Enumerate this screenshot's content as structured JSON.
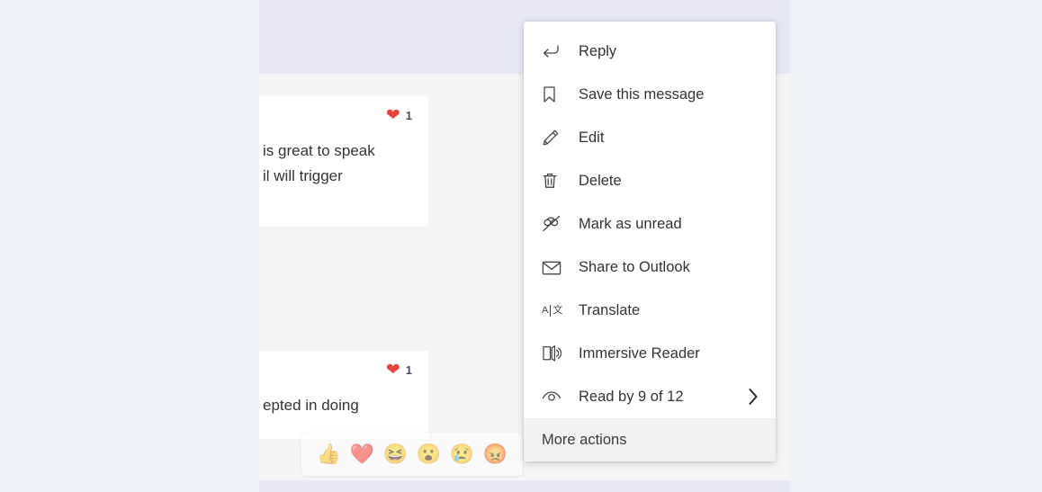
{
  "app": {
    "name": "microsoft-teams-chat",
    "background_color": "#eff3f7",
    "content_background_color": "#f5f5f5",
    "highlight_band_color": "#e7e8f3"
  },
  "messages": [
    {
      "text_line_1": "is great to speak",
      "text_line_2": "il will trigger",
      "reaction": {
        "emoji": "❤",
        "emoji_name": "heart-reaction",
        "count": "1",
        "color": "#e8453c"
      }
    },
    {
      "text_line_1": "epted in doing",
      "text_line_2": "",
      "reaction": {
        "emoji": "❤",
        "emoji_name": "heart-reaction",
        "count": "1",
        "color": "#e8453c"
      }
    }
  ],
  "reaction_bar": {
    "name": "emoji-reaction-picker",
    "emojis": [
      {
        "name": "thumbs-up-emoji",
        "glyph": "👍"
      },
      {
        "name": "heart-emoji",
        "glyph": "❤️"
      },
      {
        "name": "laugh-emoji",
        "glyph": "😆"
      },
      {
        "name": "surprised-emoji",
        "glyph": "😮"
      },
      {
        "name": "sad-emoji",
        "glyph": "😢"
      },
      {
        "name": "angry-emoji",
        "glyph": "😡"
      }
    ]
  },
  "context_menu": {
    "name": "message-context-menu",
    "items": [
      {
        "id": "reply",
        "label": "Reply",
        "icon": "reply-arrow-icon",
        "has_submenu": false
      },
      {
        "id": "save",
        "label": "Save this message",
        "icon": "bookmark-icon",
        "has_submenu": false
      },
      {
        "id": "edit",
        "label": "Edit",
        "icon": "pencil-icon",
        "has_submenu": false
      },
      {
        "id": "delete",
        "label": "Delete",
        "icon": "trash-icon",
        "has_submenu": false
      },
      {
        "id": "mark-as-unread",
        "label": "Mark as unread",
        "icon": "mail-unread-icon",
        "has_submenu": false
      },
      {
        "id": "share-to-outlook",
        "label": "Share to Outlook",
        "icon": "envelope-icon",
        "has_submenu": false
      },
      {
        "id": "translate",
        "label": "Translate",
        "icon": "translate-icon",
        "has_submenu": false
      },
      {
        "id": "immersive-reader",
        "label": "Immersive Reader",
        "icon": "immersive-reader-icon",
        "has_submenu": false
      },
      {
        "id": "read-by",
        "label": "Read by 9 of 12",
        "icon": "eye-icon",
        "has_submenu": true
      }
    ],
    "footer": {
      "id": "more-actions",
      "label": "More actions"
    }
  }
}
